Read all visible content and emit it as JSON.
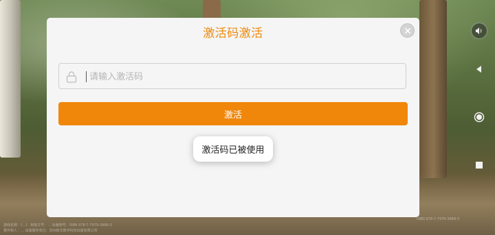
{
  "dialog": {
    "title": "激活码激活",
    "input_placeholder": "请输入激活码",
    "input_value": "",
    "activate_label": "激活",
    "toast_message": "激活码已被使用"
  },
  "background": {
    "footer_lines": [
      "游戏名称：《…》  审批文号：…  出版物号：ISBN 978-7-7979-3968-3",
      "著作权人：…  出版服务单位：苏州新华数字科技出版有限公司"
    ],
    "footer_right": "ISBN 978-7-7979-3968-3"
  },
  "nav": {
    "icons": [
      "sound-icon",
      "back-icon",
      "home-icon",
      "recent-apps-icon"
    ]
  },
  "colors": {
    "accent": "#f0870a",
    "title": "#ee8a0e",
    "dialog_bg": "#f5f5f5"
  }
}
